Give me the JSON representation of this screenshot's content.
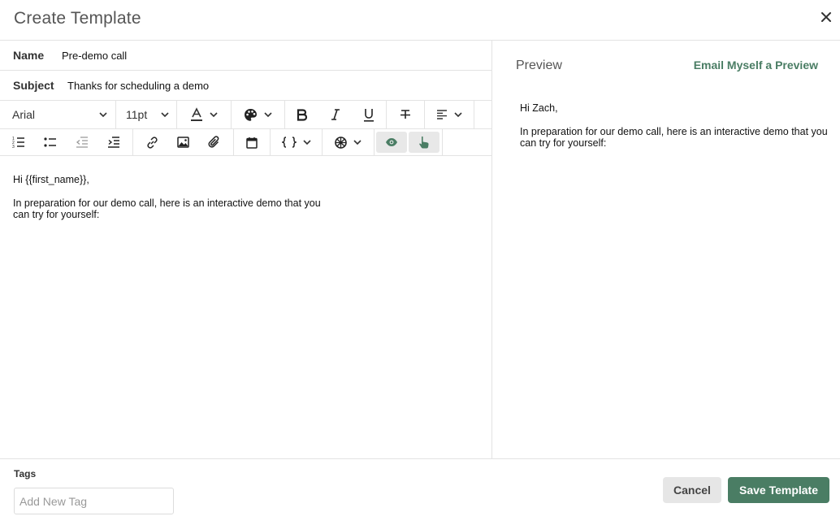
{
  "header": {
    "title": "Create Template"
  },
  "form": {
    "name_label": "Name",
    "name_value": "Pre-demo call",
    "subject_label": "Subject",
    "subject_value": "Thanks for scheduling a demo"
  },
  "toolbar": {
    "font_family": "Arial",
    "font_size": "11pt",
    "icons": [
      "text-color-icon",
      "palette-icon",
      "bold-icon",
      "italic-icon",
      "underline-icon",
      "strikethrough-icon",
      "align-left-icon",
      "numbered-list-icon",
      "bulleted-list-icon",
      "outdent-icon",
      "indent-icon",
      "link-icon",
      "image-icon",
      "attachment-icon",
      "calendar-icon",
      "variables-icon",
      "interactive-demo-icon",
      "preview-eye-icon",
      "click-hand-icon"
    ]
  },
  "editor": {
    "greeting": "Hi {{first_name}},",
    "paragraph": "In preparation for our demo call, here is an interactive demo that you can try for yourself:"
  },
  "preview": {
    "title": "Preview",
    "email_link": "Email Myself a Preview",
    "greeting": "Hi Zach,",
    "paragraph": "In preparation for our demo call, here is an interactive demo that you can try for yourself:"
  },
  "footer": {
    "tags_label": "Tags",
    "tag_placeholder": "Add New Tag",
    "cancel_label": "Cancel",
    "save_label": "Save Template"
  },
  "colors": {
    "accent": "#4a7d64",
    "cancel_bg": "#e6e6e6",
    "active_tool_bg": "#e8e8e8",
    "border": "#e3e3e3"
  }
}
